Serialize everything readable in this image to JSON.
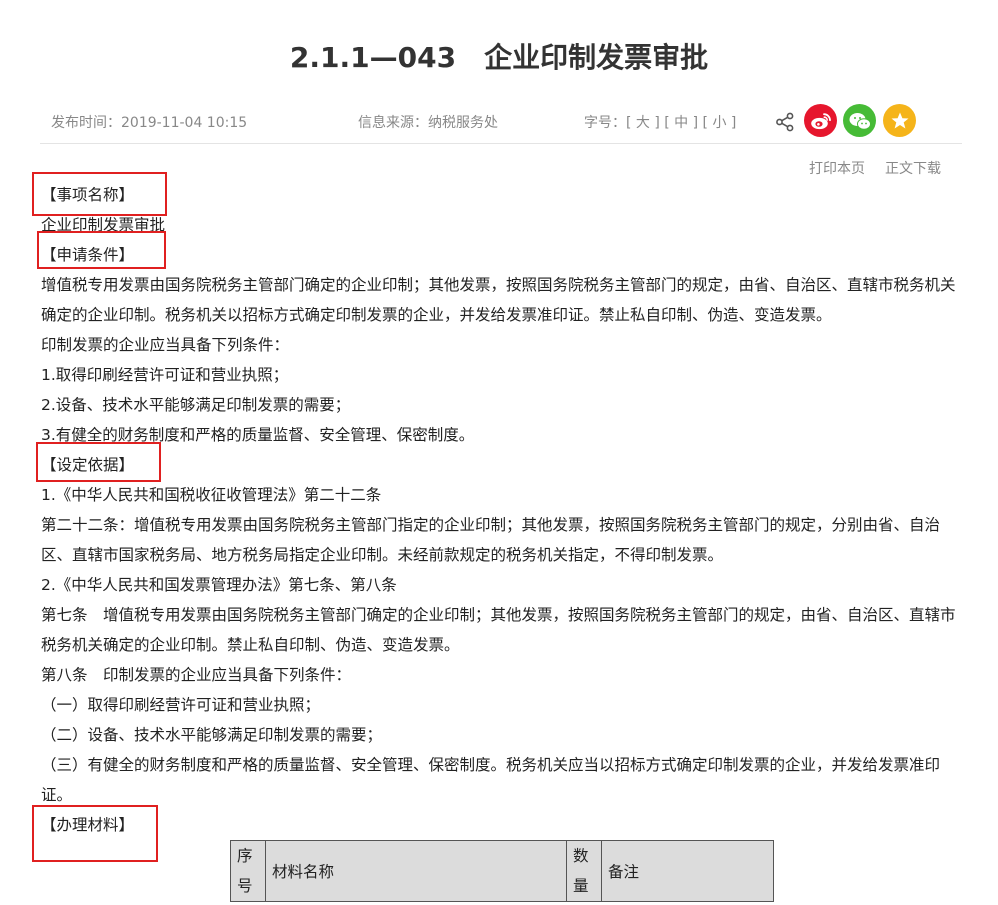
{
  "article": {
    "code": "2.1.1—043",
    "name": "企业印制发票审批",
    "publish": "发布时间：2019-11-04 10:15",
    "source": "信息来源：纳税服务处",
    "fontsize": "字号：[ 大 ] [ 中 ] [ 小 ]"
  },
  "tools": {
    "print": "打印本页",
    "download": "正文下载"
  },
  "icons": [
    "share-icon",
    "weibo-icon",
    "wechat-icon",
    "favorite-star-icon"
  ],
  "colors": {
    "weibo": "#e6162d",
    "wechat": "#46bb36",
    "star": "#f5b41a",
    "highlight_box": "#e02020"
  },
  "body": {
    "h_item": "【事项名称】",
    "item_name": "企业印制发票审批",
    "h_cond": "【申请条件】",
    "cond_1": "增值税专用发票由国务院税务主管部门确定的企业印制；其他发票，按照国务院税务主管部门的规定，由省、自治区、直辖市税务机关确定的企业印制。税务机关以招标方式确定印制发票的企业，并发给发票准印证。禁止私自印制、伪造、变造发票。",
    "cond_2": "印制发票的企业应当具备下列条件：",
    "cond_3": "1.取得印刷经营许可证和营业执照；",
    "cond_4": "2.设备、技术水平能够满足印制发票的需要；",
    "cond_5": "3.有健全的财务制度和严格的质量监督、安全管理、保密制度。",
    "h_basis": "【设定依据】",
    "basis_1": "1.《中华人民共和国税收征收管理法》第二十二条",
    "basis_2": "第二十二条：增值税专用发票由国务院税务主管部门指定的企业印制；其他发票，按照国务院税务主管部门的规定，分别由省、自治区、直辖市国家税务局、地方税务局指定企业印制。未经前款规定的税务机关指定，不得印制发票。",
    "basis_3": "2.《中华人民共和国发票管理办法》第七条、第八条",
    "basis_4": "第七条　增值税专用发票由国务院税务主管部门确定的企业印制；其他发票，按照国务院税务主管部门的规定，由省、自治区、直辖市税务机关确定的企业印制。禁止私自印制、伪造、变造发票。",
    "basis_5": "第八条　印制发票的企业应当具备下列条件：",
    "basis_6": "（一）取得印刷经营许可证和营业执照；",
    "basis_7": "（二）设备、技术水平能够满足印制发票的需要；",
    "basis_8": "（三）有健全的财务制度和严格的质量监督、安全管理、保密制度。税务机关应当以招标方式确定印制发票的企业，并发给发票准印证。",
    "h_mat": "【办理材料】"
  },
  "table": {
    "col_seq_1": "序",
    "col_seq_2": "号",
    "col_name": "材料名称",
    "col_qty_1": "数",
    "col_qty_2": "量",
    "col_note": "备注"
  }
}
